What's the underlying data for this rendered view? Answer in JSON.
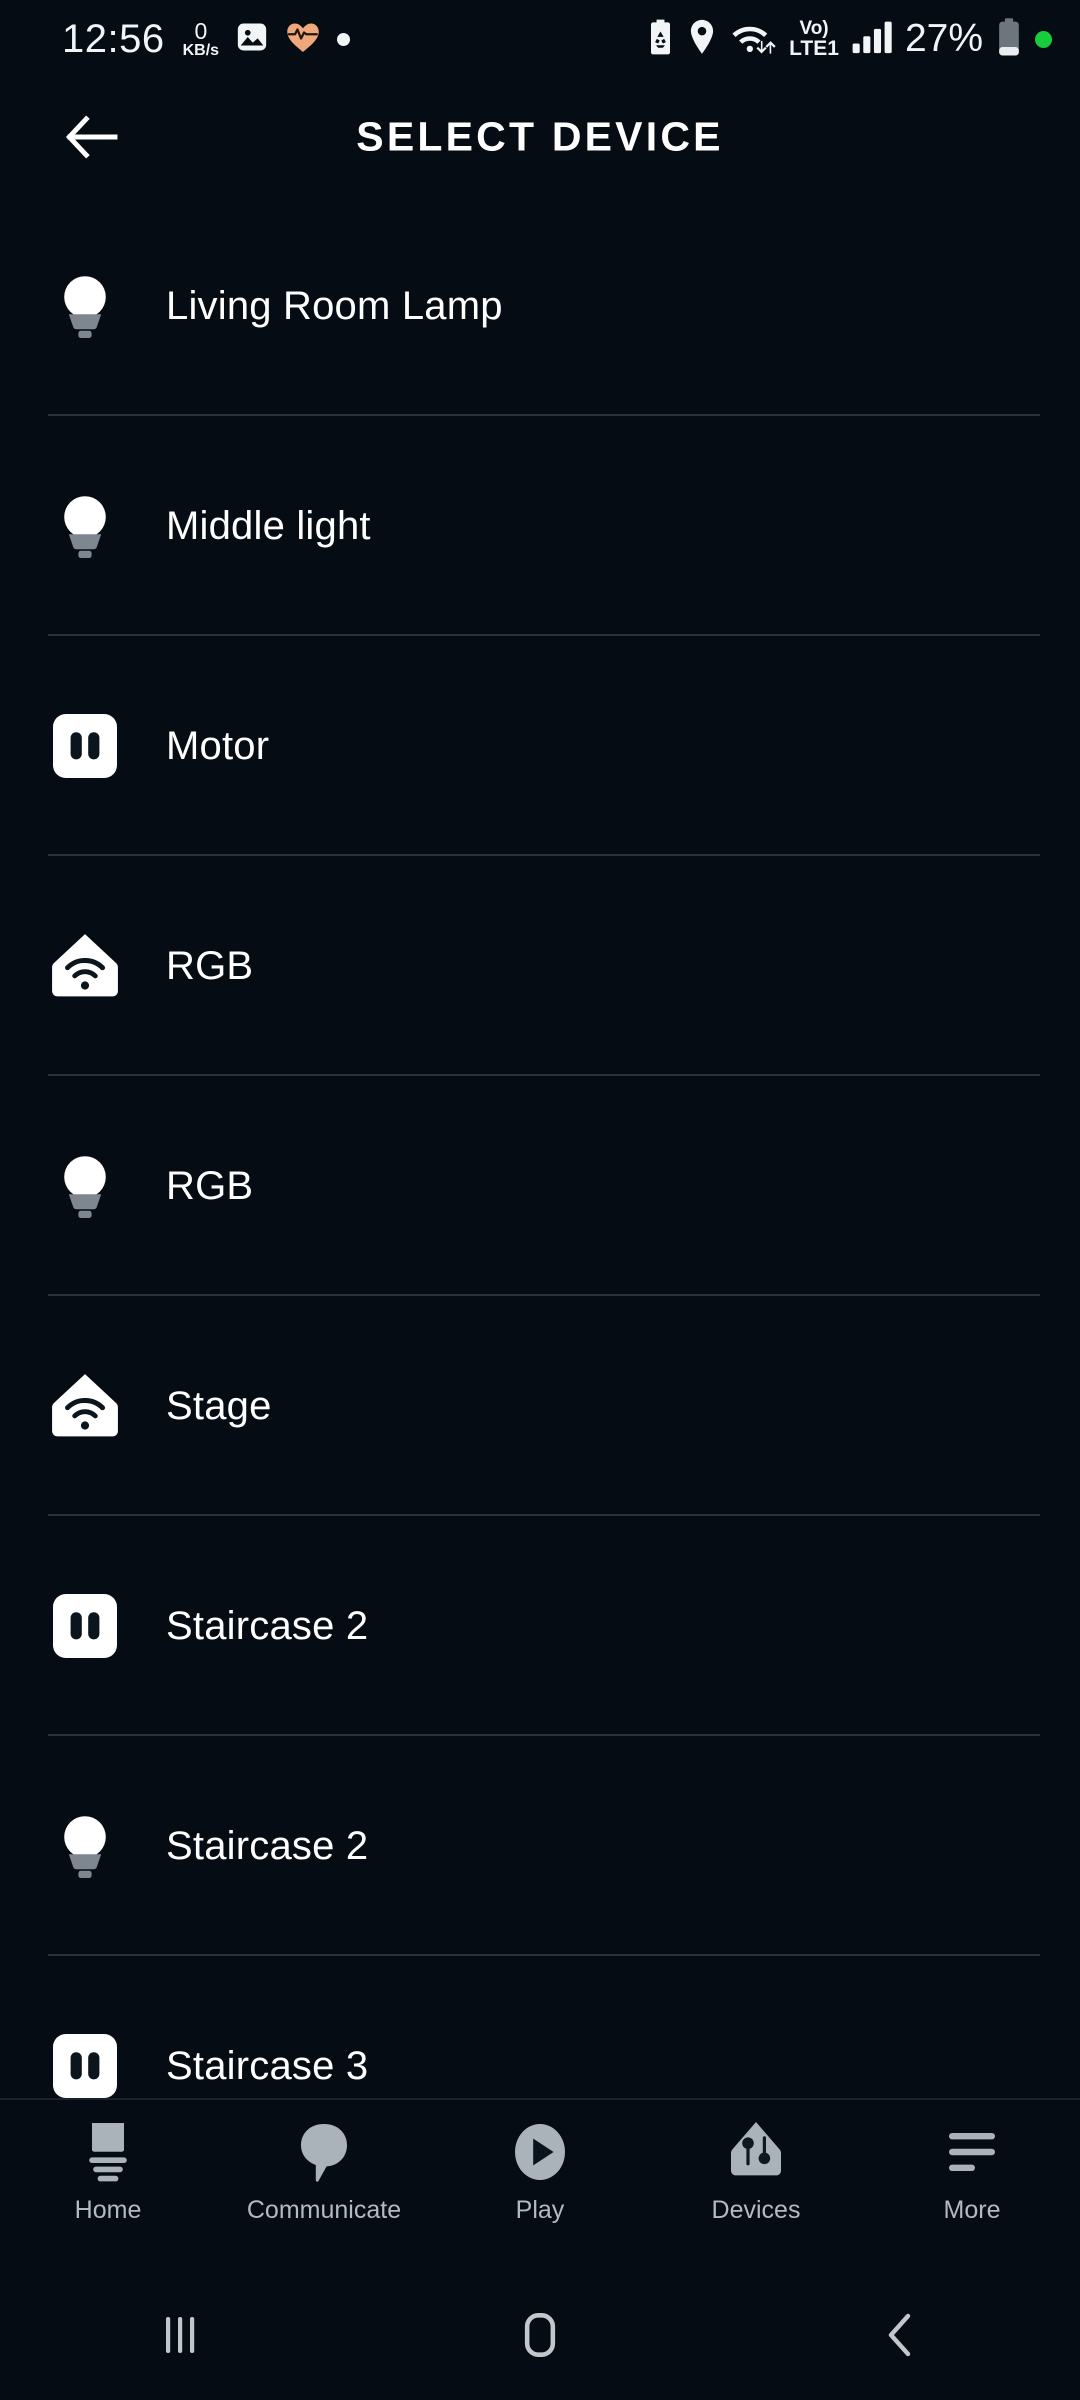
{
  "status_bar": {
    "time": "12:56",
    "net_speed_value": "0",
    "net_speed_unit": "KB/s",
    "volte_top": "Vo)",
    "volte_bottom": "LTE1",
    "battery_percent": "27%",
    "icons": {
      "gallery": "gallery-icon",
      "heart": "heart-rate-icon",
      "dot": "notification-dot-icon",
      "battery_saver": "battery-saver-icon",
      "location": "location-pin-icon",
      "wifi": "wifi-data-icon",
      "signal": "signal-bars-icon",
      "battery": "battery-icon",
      "green_dot": "privacy-indicator-dot"
    },
    "heart_color": "#efa77c",
    "green_dot_color": "#19cc3e"
  },
  "header": {
    "back_label": "back-arrow",
    "title": "SELECT DEVICE"
  },
  "device_list": {
    "items": [
      {
        "label": "Living Room Lamp",
        "icon": "bulb"
      },
      {
        "label": "Middle light",
        "icon": "bulb"
      },
      {
        "label": "Motor",
        "icon": "switch"
      },
      {
        "label": "RGB",
        "icon": "house-wifi"
      },
      {
        "label": "RGB",
        "icon": "bulb"
      },
      {
        "label": "Stage",
        "icon": "house-wifi"
      },
      {
        "label": "Staircase 2",
        "icon": "switch"
      },
      {
        "label": "Staircase 2",
        "icon": "bulb"
      },
      {
        "label": "Staircase 3",
        "icon": "switch"
      }
    ]
  },
  "bottom_nav": {
    "items": [
      {
        "label": "Home",
        "icon": "echo-device-icon"
      },
      {
        "label": "Communicate",
        "icon": "speech-bubble-icon"
      },
      {
        "label": "Play",
        "icon": "play-circle-icon"
      },
      {
        "label": "Devices",
        "icon": "house-devices-icon"
      },
      {
        "label": "More",
        "icon": "more-lines-icon"
      }
    ]
  },
  "android_nav": {
    "recents": "recents-icon",
    "home": "home-icon",
    "back": "back-icon"
  },
  "colors": {
    "background": "#050c13",
    "separator": "#28333d",
    "text": "#ffffff",
    "nav_inactive": "#b2bac2"
  }
}
